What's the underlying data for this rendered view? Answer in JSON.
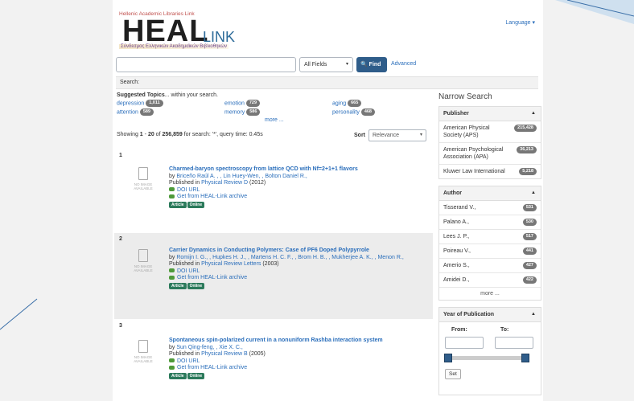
{
  "header": {
    "logo_top": "Hellenic Academic Libraries Link",
    "logo_heal": "HEAL",
    "logo_link": "LINK",
    "logo_sub": "Σύνδεσμος Ελληνικών Ακαδημαϊκών Βιβλιοθηκών",
    "language": "Language ▾"
  },
  "search": {
    "query": "",
    "field": "All Fields",
    "find_label": "Find",
    "advanced_label": "Advanced",
    "search_label": "Search:"
  },
  "topics": {
    "title_bold": "Suggested Topics",
    "title_rest": "... within your search.",
    "items": [
      {
        "label": "depression",
        "count": "1,011"
      },
      {
        "label": "attention",
        "count": "589"
      },
      {
        "label": "emotion",
        "count": "729"
      },
      {
        "label": "memory",
        "count": "586"
      },
      {
        "label": "aging",
        "count": "665"
      },
      {
        "label": "personality",
        "count": "468"
      }
    ],
    "more_label": "more ..."
  },
  "results_summary": {
    "showing": "Showing ",
    "from": "1",
    "dash": " - ",
    "to": "20",
    "of_text": " of ",
    "total": "256,859",
    "rest": " for search: '*', query time: 0.45s",
    "sort_label": "Sort",
    "sort_value": "Relevance"
  },
  "no_image_text": "NO IMAGE AVAILABLE",
  "results": [
    {
      "num": "1",
      "title": "Charmed-baryon spectroscopy from lattice QCD with Nf=2+1+1 flavors",
      "by": "by ",
      "authors": "Briceño Raúl A. , , Lin Huey-Wen, , Bolton Daniel R.,",
      "published_in": "Published in ",
      "journal": "Physical Review D",
      "year": " (2012)",
      "doi": "DOI URL",
      "archive": "Get from HEAL-Link archive",
      "tags": [
        "Article",
        "Online"
      ]
    },
    {
      "num": "2",
      "title": "Carrier Dynamics in Conducting Polymers: Case of PF6 Doped Polypyrrole",
      "by": "by ",
      "authors": "Romijn I. G., , Hupkes H. J., , Martens H. C. F., , Brom H. B., , Mukherjee A. K., , Menon R.,",
      "published_in": "Published in ",
      "journal": "Physical Review Letters",
      "year": " (2003)",
      "doi": "DOI URL",
      "archive": "Get from HEAL-Link archive",
      "tags": [
        "Article",
        "Online"
      ]
    },
    {
      "num": "3",
      "title": "Spontaneous spin-polarized current in a nonuniform Rashba interaction system",
      "by": "by ",
      "authors": "Sun Qing-feng, , Xie X. C.,",
      "published_in": "Published in ",
      "journal": "Physical Review B",
      "year": " (2005)",
      "doi": "DOI URL",
      "archive": "Get from HEAL-Link archive",
      "tags": [
        "Article",
        "Online"
      ]
    }
  ],
  "sidebar": {
    "title": "Narrow Search",
    "publisher": {
      "label": "Publisher",
      "items": [
        {
          "label": "American Physical Society (APS)",
          "count": "215,428"
        },
        {
          "label": "American Psychological Association (APA)",
          "count": "36,213"
        },
        {
          "label": "Kluwer Law International",
          "count": "5,218"
        }
      ]
    },
    "author": {
      "label": "Author",
      "items": [
        {
          "label": "Tisserand V.,",
          "count": "531"
        },
        {
          "label": "Palano A.,",
          "count": "530"
        },
        {
          "label": "Lees J. P.,",
          "count": "517"
        },
        {
          "label": "Poireau V.,",
          "count": "441"
        },
        {
          "label": "Amerio S.,",
          "count": "427"
        },
        {
          "label": "Amidei D.,",
          "count": "422"
        }
      ],
      "more_label": "more ..."
    },
    "year": {
      "label": "Year of Publication",
      "from_label": "From:",
      "to_label": "To:",
      "set_label": "Set"
    }
  },
  "colors": {
    "accent": "#2f5d8a",
    "link": "#2a6ebb",
    "tag": "#2b7a5b",
    "badge": "#777777"
  }
}
